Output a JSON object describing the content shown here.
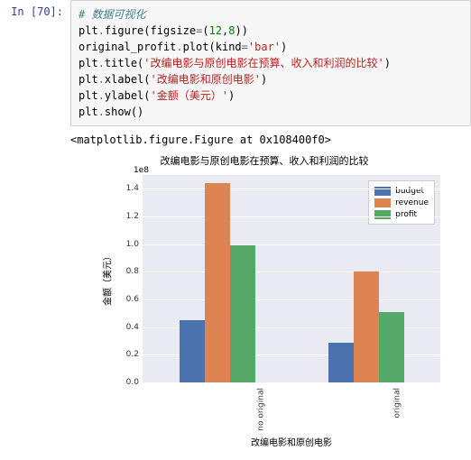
{
  "cell": {
    "prompt": "In [70]:",
    "code_lines": [
      {
        "segments": [
          {
            "cls": "c-comment",
            "t": "# 数据可视化"
          }
        ]
      },
      {
        "segments": [
          {
            "cls": "c-id",
            "t": "plt"
          },
          {
            "cls": "c-op",
            "t": "."
          },
          {
            "cls": "c-id",
            "t": "figure"
          },
          {
            "cls": "c-paren",
            "t": "("
          },
          {
            "cls": "c-id",
            "t": "figsize"
          },
          {
            "cls": "c-op",
            "t": "="
          },
          {
            "cls": "c-paren",
            "t": "("
          },
          {
            "cls": "c-num",
            "t": "12"
          },
          {
            "cls": "c-paren",
            "t": ","
          },
          {
            "cls": "c-num",
            "t": "8"
          },
          {
            "cls": "c-paren",
            "t": "))"
          }
        ]
      },
      {
        "segments": [
          {
            "cls": "c-id",
            "t": "original_profit"
          },
          {
            "cls": "c-op",
            "t": "."
          },
          {
            "cls": "c-id",
            "t": "plot"
          },
          {
            "cls": "c-paren",
            "t": "("
          },
          {
            "cls": "c-id",
            "t": "kind"
          },
          {
            "cls": "c-op",
            "t": "="
          },
          {
            "cls": "c-str",
            "t": "'bar'"
          },
          {
            "cls": "c-paren",
            "t": ")"
          }
        ]
      },
      {
        "segments": [
          {
            "cls": "c-id",
            "t": "plt"
          },
          {
            "cls": "c-op",
            "t": "."
          },
          {
            "cls": "c-id",
            "t": "title"
          },
          {
            "cls": "c-paren",
            "t": "("
          },
          {
            "cls": "c-str",
            "t": "'改编电影与原创电影在预算、收入和利润的比较'"
          },
          {
            "cls": "c-paren",
            "t": ")"
          }
        ]
      },
      {
        "segments": [
          {
            "cls": "c-id",
            "t": "plt"
          },
          {
            "cls": "c-op",
            "t": "."
          },
          {
            "cls": "c-id",
            "t": "xlabel"
          },
          {
            "cls": "c-paren",
            "t": "("
          },
          {
            "cls": "c-str",
            "t": "'改编电影和原创电影'"
          },
          {
            "cls": "c-paren",
            "t": ")"
          }
        ]
      },
      {
        "segments": [
          {
            "cls": "c-id",
            "t": "plt"
          },
          {
            "cls": "c-op",
            "t": "."
          },
          {
            "cls": "c-id",
            "t": "ylabel"
          },
          {
            "cls": "c-paren",
            "t": "("
          },
          {
            "cls": "c-str",
            "t": "'金额（美元）'"
          },
          {
            "cls": "c-paren",
            "t": ")"
          }
        ]
      },
      {
        "segments": [
          {
            "cls": "c-id",
            "t": "plt"
          },
          {
            "cls": "c-op",
            "t": "."
          },
          {
            "cls": "c-id",
            "t": "show"
          },
          {
            "cls": "c-paren",
            "t": "()"
          }
        ]
      }
    ]
  },
  "output_repr": "<matplotlib.figure.Figure at 0x108400f0>",
  "chart_data": {
    "type": "bar",
    "title": "改编电影与原创电影在预算、收入和利润的比较",
    "xlabel": "改编电影和原创电影",
    "ylabel": "金额（美元）",
    "y_exp_label": "1e8",
    "ylim": [
      0.0,
      1.5
    ],
    "yticks": [
      0.0,
      0.2,
      0.4,
      0.6,
      0.8,
      1.0,
      1.2,
      1.4
    ],
    "categories": [
      "no original",
      "original"
    ],
    "series": [
      {
        "name": "budget",
        "values": [
          0.45,
          0.29
        ]
      },
      {
        "name": "revenue",
        "values": [
          1.44,
          0.8
        ]
      },
      {
        "name": "profit",
        "values": [
          0.99,
          0.51
        ]
      }
    ],
    "legend_position": "upper right",
    "colors": {
      "budget": "#4C72B0",
      "revenue": "#DD8452",
      "profit": "#55A868"
    }
  }
}
